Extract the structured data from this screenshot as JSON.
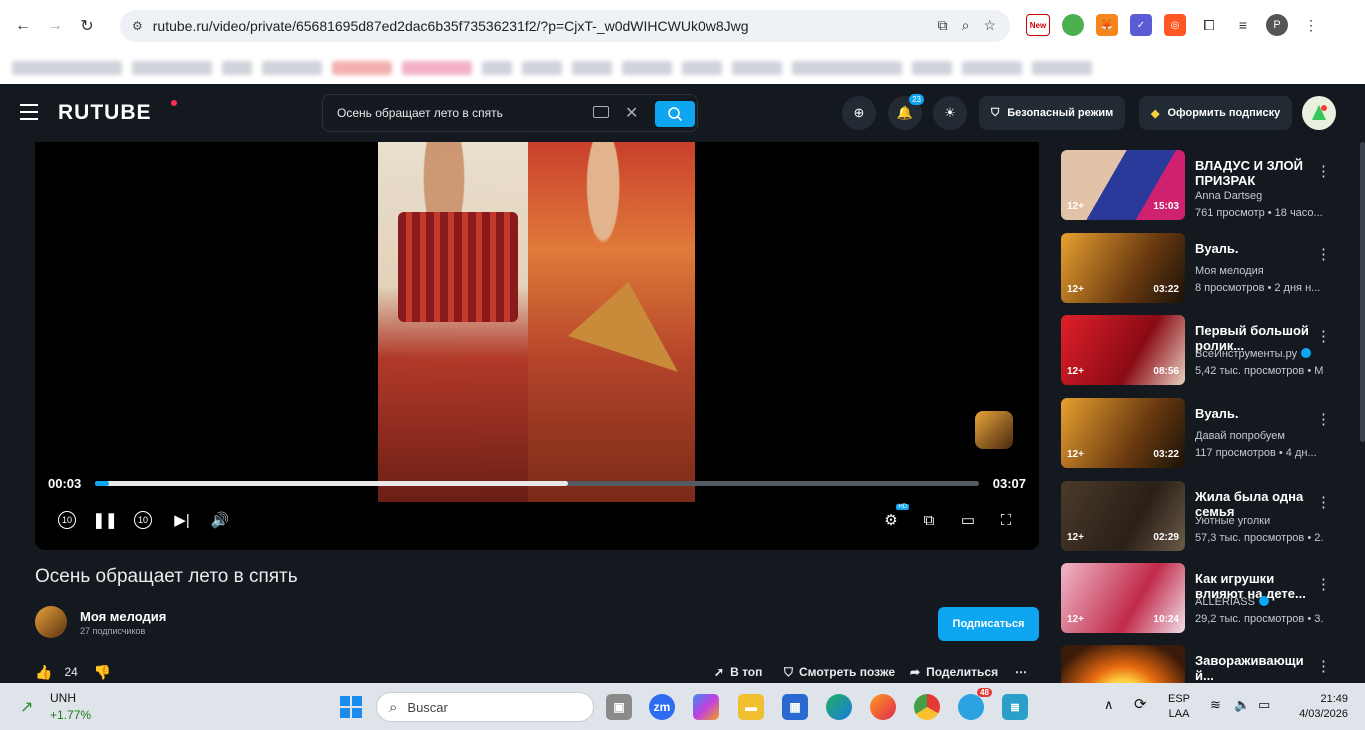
{
  "browser": {
    "url": "rutube.ru/video/private/65681695d87ed2dac6b35f73536231f2/?p=CjxT-_w0dWIHCWUk0w8Jwg",
    "new_badge": "New",
    "profile_initial": "P"
  },
  "header": {
    "logo": "RUTUBE",
    "search_query": "Осень обращает лето в спять",
    "notif_count": "23",
    "safe_mode": "Безопасный режим",
    "subscribe_cta": "Оформить подписку"
  },
  "player": {
    "current_time": "00:03",
    "total_time": "03:07",
    "progress": 0.535,
    "hd_badge": "HD",
    "rewind_label": "10",
    "forward_label": "10"
  },
  "video": {
    "title": "Осень обращает лето в спять",
    "channel_name": "Моя мелодия",
    "channel_subs": "27 подписчиков",
    "subscribe_button": "Подписаться",
    "likes": "24",
    "action_top": "В топ",
    "action_later": "Смотреть позже",
    "action_share": "Поделиться"
  },
  "sidebar": {
    "items": [
      {
        "title": "ВЛАДУС И ЗЛОЙ ПРИЗРАК",
        "channel": "Anna Dartseg",
        "meta": "761 просмотр • 18 часо...",
        "age": "12+",
        "duration": "15:03",
        "verified": false
      },
      {
        "title": "Вуаль.",
        "channel": "Моя мелодия",
        "meta": "8 просмотров • 2 дня н...",
        "age": "12+",
        "duration": "03:22",
        "verified": false
      },
      {
        "title": "Первый большой ролик...",
        "channel": "ВсеИнструменты.ру",
        "meta": "5,42 тыс. просмотров • М",
        "age": "12+",
        "duration": "08:56",
        "verified": true
      },
      {
        "title": "Вуаль.",
        "channel": "Давай попробуем",
        "meta": "117 просмотров • 4 дн...",
        "age": "12+",
        "duration": "03:22",
        "verified": false
      },
      {
        "title": "Жила была одна семья",
        "channel": "Уютные уголки",
        "meta": "57,3 тыс. просмотров • 2.",
        "age": "12+",
        "duration": "02:29",
        "verified": false
      },
      {
        "title": "Как игрушки влияют на дете...",
        "channel": "ALLERIASS",
        "meta": "29,2 тыс. просмотров • 3.",
        "age": "12+",
        "duration": "10:24",
        "verified": true
      },
      {
        "title": "Завораживающи й...",
        "channel": "",
        "meta": "",
        "age": "",
        "duration": "",
        "verified": false
      }
    ]
  },
  "taskbar": {
    "stock_symbol": "UNH",
    "stock_change": "+1.77%",
    "search_placeholder": "Buscar",
    "zoom_label": "zm",
    "telegram_badge": "48",
    "lang": "ESP",
    "lang_sub": "LAA",
    "time": "21:49",
    "date": "4/03/2026"
  },
  "colors": {
    "accent": "#0ea5f1",
    "bg": "#14191f"
  }
}
